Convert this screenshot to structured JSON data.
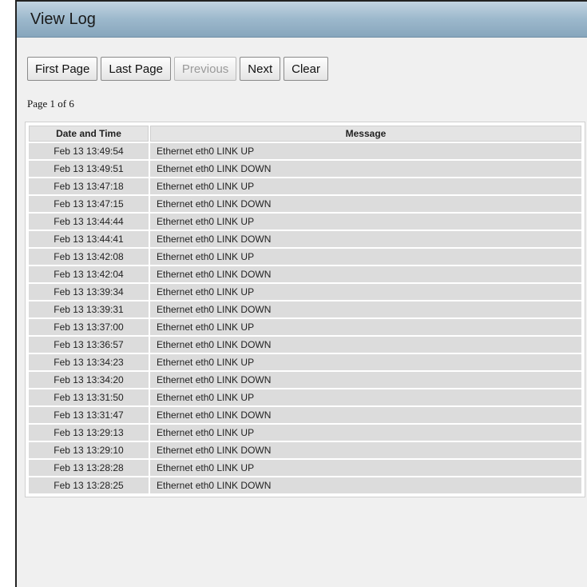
{
  "header": {
    "title": "View Log"
  },
  "toolbar": {
    "first_page": "First Page",
    "last_page": "Last Page",
    "previous": "Previous",
    "next": "Next",
    "clear": "Clear"
  },
  "pagination": {
    "text": "Page 1 of 6"
  },
  "log_table": {
    "columns": [
      "Date and Time",
      "Message"
    ],
    "rows": [
      [
        "Feb 13 13:49:54",
        "Ethernet eth0 LINK UP"
      ],
      [
        "Feb 13 13:49:51",
        "Ethernet eth0 LINK DOWN"
      ],
      [
        "Feb 13 13:47:18",
        "Ethernet eth0 LINK UP"
      ],
      [
        "Feb 13 13:47:15",
        "Ethernet eth0 LINK DOWN"
      ],
      [
        "Feb 13 13:44:44",
        "Ethernet eth0 LINK UP"
      ],
      [
        "Feb 13 13:44:41",
        "Ethernet eth0 LINK DOWN"
      ],
      [
        "Feb 13 13:42:08",
        "Ethernet eth0 LINK UP"
      ],
      [
        "Feb 13 13:42:04",
        "Ethernet eth0 LINK DOWN"
      ],
      [
        "Feb 13 13:39:34",
        "Ethernet eth0 LINK UP"
      ],
      [
        "Feb 13 13:39:31",
        "Ethernet eth0 LINK DOWN"
      ],
      [
        "Feb 13 13:37:00",
        "Ethernet eth0 LINK UP"
      ],
      [
        "Feb 13 13:36:57",
        "Ethernet eth0 LINK DOWN"
      ],
      [
        "Feb 13 13:34:23",
        "Ethernet eth0 LINK UP"
      ],
      [
        "Feb 13 13:34:20",
        "Ethernet eth0 LINK DOWN"
      ],
      [
        "Feb 13 13:31:50",
        "Ethernet eth0 LINK UP"
      ],
      [
        "Feb 13 13:31:47",
        "Ethernet eth0 LINK DOWN"
      ],
      [
        "Feb 13 13:29:13",
        "Ethernet eth0 LINK UP"
      ],
      [
        "Feb 13 13:29:10",
        "Ethernet eth0 LINK DOWN"
      ],
      [
        "Feb 13 13:28:28",
        "Ethernet eth0 LINK UP"
      ],
      [
        "Feb 13 13:28:25",
        "Ethernet eth0 LINK DOWN"
      ]
    ]
  }
}
